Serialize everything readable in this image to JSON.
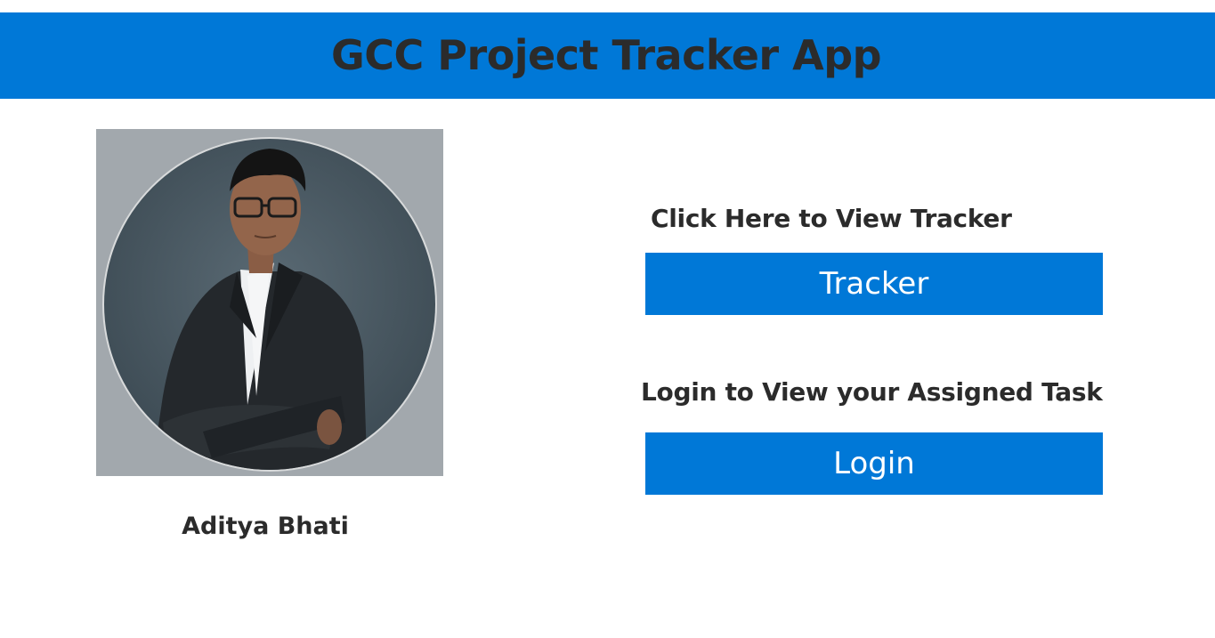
{
  "header": {
    "title": "GCC Project Tracker App"
  },
  "profile": {
    "name": "Aditya Bhati",
    "photo": "profile-photo-icon"
  },
  "tracker_section": {
    "label": "Click Here to View Tracker",
    "button_label": "Tracker"
  },
  "login_section": {
    "label": "Login to View your Assigned Task",
    "button_label": "Login"
  },
  "colors": {
    "primary": "#0078d7",
    "text": "#2b2b2b",
    "button_text": "#ffffff",
    "photo_backdrop": "#a2a8ad"
  }
}
